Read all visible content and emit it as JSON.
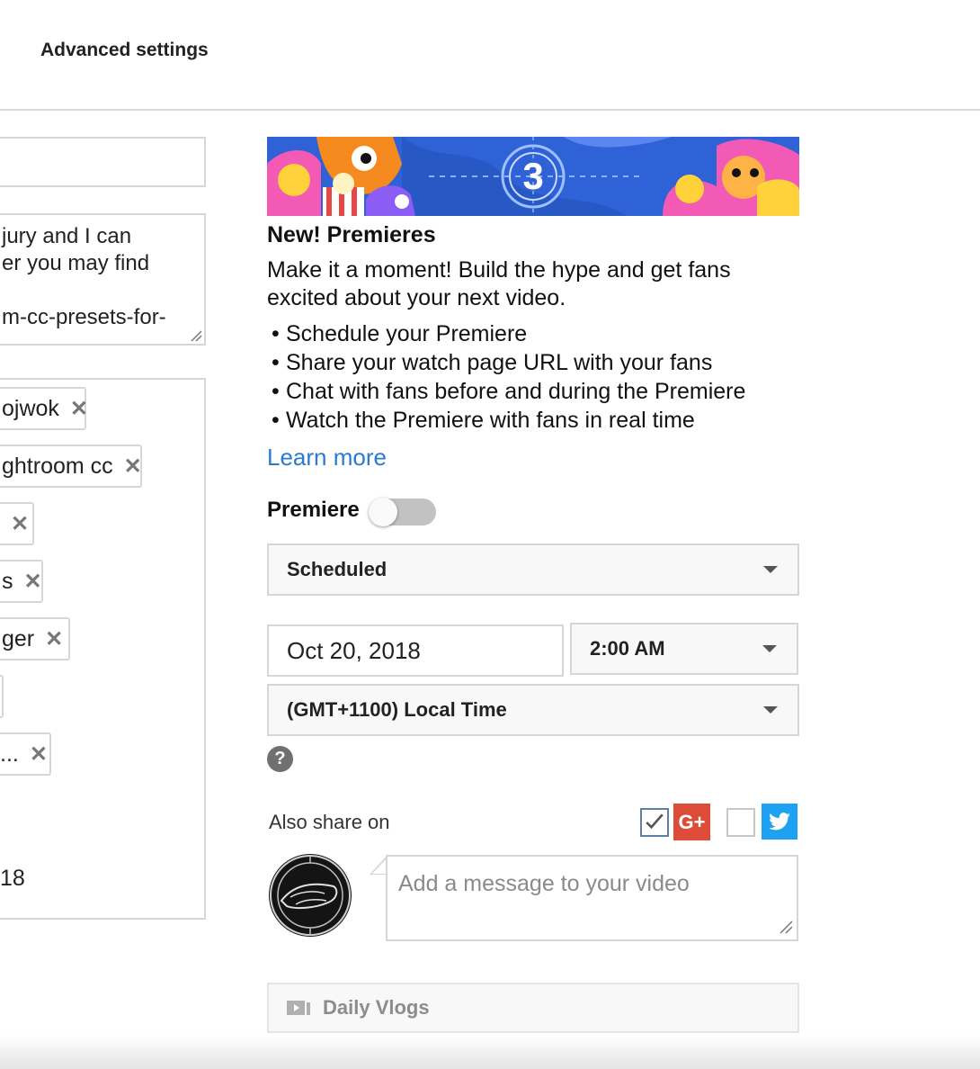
{
  "header": {
    "tab_label": "Advanced settings"
  },
  "left_column": {
    "description_lines": [
      "jury and I can",
      "er you may find",
      "",
      "m-cc-presets-for-"
    ],
    "tags": [
      {
        "label": "ojwok"
      },
      {
        "label": "ghtroom cc"
      },
      {
        "label": ""
      },
      {
        "label": "s"
      },
      {
        "label": "ger"
      },
      {
        "label": ""
      },
      {
        "label": "..."
      }
    ],
    "date_fragment": "18"
  },
  "promo": {
    "banner_number": "3",
    "title": "New! Premieres",
    "description": "Make it a moment! Build the hype and get fans excited about your next video.",
    "bullets": [
      "Schedule your Premiere",
      "Share your watch page URL with your fans",
      "Chat with fans before and during the Premiere",
      "Watch the Premiere with fans in real time"
    ],
    "learn_more": "Learn more"
  },
  "premiere": {
    "label": "Premiere",
    "toggle_on": false,
    "visibility_value": "Scheduled",
    "date_value": "Oct 20, 2018",
    "time_value": "2:00 AM",
    "timezone_value": "(GMT+1100) Local Time",
    "help_glyph": "?"
  },
  "share": {
    "label": "Also share on",
    "google_plus_checked": true,
    "google_plus_glyph": "G+",
    "twitter_checked": false,
    "message_placeholder": "Add a message to your video"
  },
  "playlist": {
    "label": "Daily Vlogs",
    "icon": "playlist-icon"
  },
  "colors": {
    "link": "#2a7ad3",
    "google_plus": "#dd4b39",
    "twitter": "#1da1f2",
    "banner_bg": "#2f62d6"
  }
}
